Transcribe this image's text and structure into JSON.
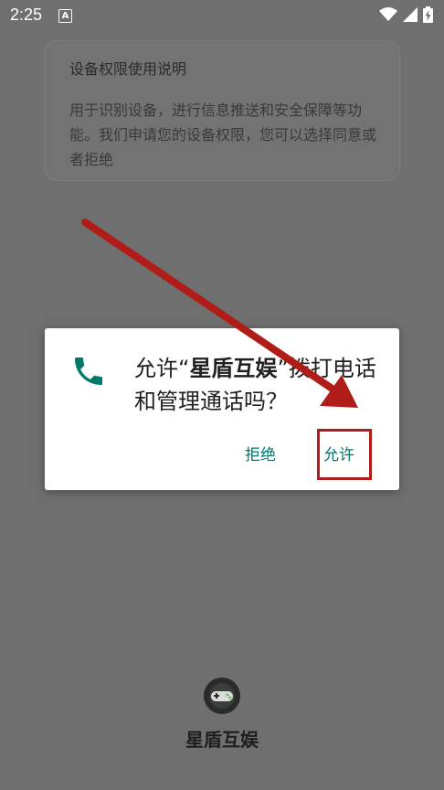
{
  "status_bar": {
    "time": "2:25",
    "notification_icon": "A",
    "icons": [
      "wifi-icon",
      "signal-icon",
      "battery-charging-icon"
    ]
  },
  "permission_card": {
    "title": "设备权限使用说明",
    "description": "用于识别设备，进行信息推送和安全保障等功能。我们申请您的设备权限，您可以选择同意或者拒绝"
  },
  "dialog": {
    "icon": "phone-icon",
    "message_prefix": "允许“",
    "app_name": "星盾互娱",
    "message_suffix": "”拨打电话和管理通话吗？",
    "deny_label": "拒绝",
    "allow_label": "允许",
    "accent_color": "#00796b"
  },
  "annotation": {
    "arrow_color": "#b01c18",
    "highlight_target": "allow-button"
  },
  "app": {
    "name": "星盾互娱",
    "logo_icon": "gamepad-icon"
  }
}
